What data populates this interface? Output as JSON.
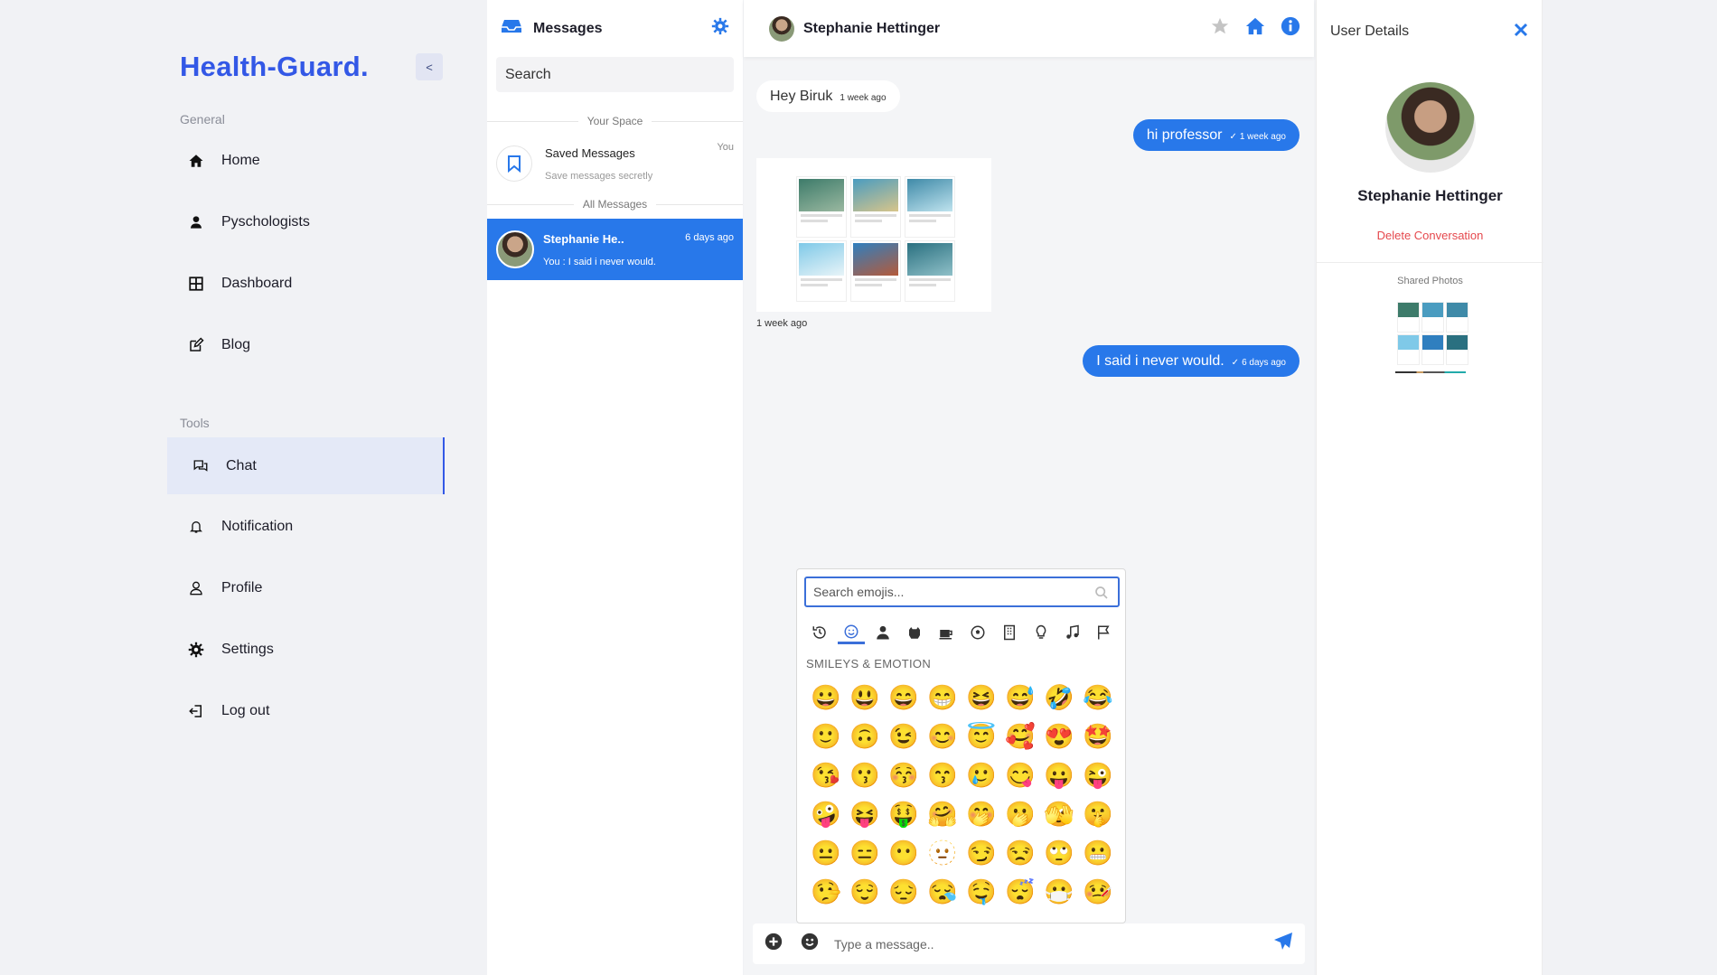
{
  "sidebar": {
    "brand": "Health-Guard.",
    "collapse_label": "<",
    "general_label": "General",
    "tools_label": "Tools",
    "items": [
      {
        "label": "Home"
      },
      {
        "label": "Pyschologists"
      },
      {
        "label": "Dashboard"
      },
      {
        "label": "Blog"
      },
      {
        "label": "Chat"
      },
      {
        "label": "Notification"
      },
      {
        "label": "Profile"
      },
      {
        "label": "Settings"
      },
      {
        "label": "Log out"
      }
    ]
  },
  "conversations": {
    "title": "Messages",
    "search_placeholder": "Search",
    "your_space_label": "Your Space",
    "saved": {
      "name": "Saved Messages",
      "sub": "Save messages secretly",
      "tag": "You"
    },
    "all_messages_label": "All Messages",
    "items": [
      {
        "name": "Stephanie He..",
        "time": "6 days ago",
        "last": "You : I said i never would."
      }
    ]
  },
  "chat": {
    "contact_name": "Stephanie Hettinger",
    "messages": [
      {
        "text": "Hey Biruk",
        "time": "1 week ago",
        "dir": "in"
      },
      {
        "text": "hi professor",
        "time": "1 week ago",
        "dir": "out"
      },
      {
        "image_caption": "1 week ago",
        "dir": "in"
      },
      {
        "text": "I said i never would.",
        "time": "6 days ago",
        "dir": "out"
      }
    ],
    "composer_placeholder": "Type a message.."
  },
  "emoji_picker": {
    "search_placeholder": "Search emojis...",
    "categories": [
      "recent-icon",
      "smileys-icon",
      "people-icon",
      "animals-icon",
      "food-icon",
      "activity-icon",
      "places-icon",
      "objects-icon",
      "symbols-icon",
      "flags-icon"
    ],
    "active_category": "smileys-icon",
    "section_label": "SMILEYS & EMOTION",
    "emojis": [
      "😀",
      "😃",
      "😄",
      "😁",
      "😆",
      "😅",
      "🤣",
      "😂",
      "🙂",
      "🙃",
      "😉",
      "😊",
      "😇",
      "🥰",
      "😍",
      "🤩",
      "😘",
      "😗",
      "😚",
      "😙",
      "🥲",
      "😋",
      "😛",
      "😜",
      "🤪",
      "😝",
      "🤑",
      "🤗",
      "🤭",
      "🫢",
      "🫣",
      "🤫",
      "😐",
      "😑",
      "😶",
      "🫥",
      "😏",
      "😒",
      "🙄",
      "😬",
      "🤥",
      "😌",
      "😔",
      "😪",
      "🤤",
      "😴",
      "😷",
      "🤒"
    ]
  },
  "details": {
    "title": "User Details",
    "name": "Stephanie Hettinger",
    "delete_label": "Delete Conversation",
    "shared_label": "Shared Photos"
  },
  "colors": {
    "accent": "#2878ea",
    "brand": "#3358e6",
    "danger": "#e5484d"
  }
}
